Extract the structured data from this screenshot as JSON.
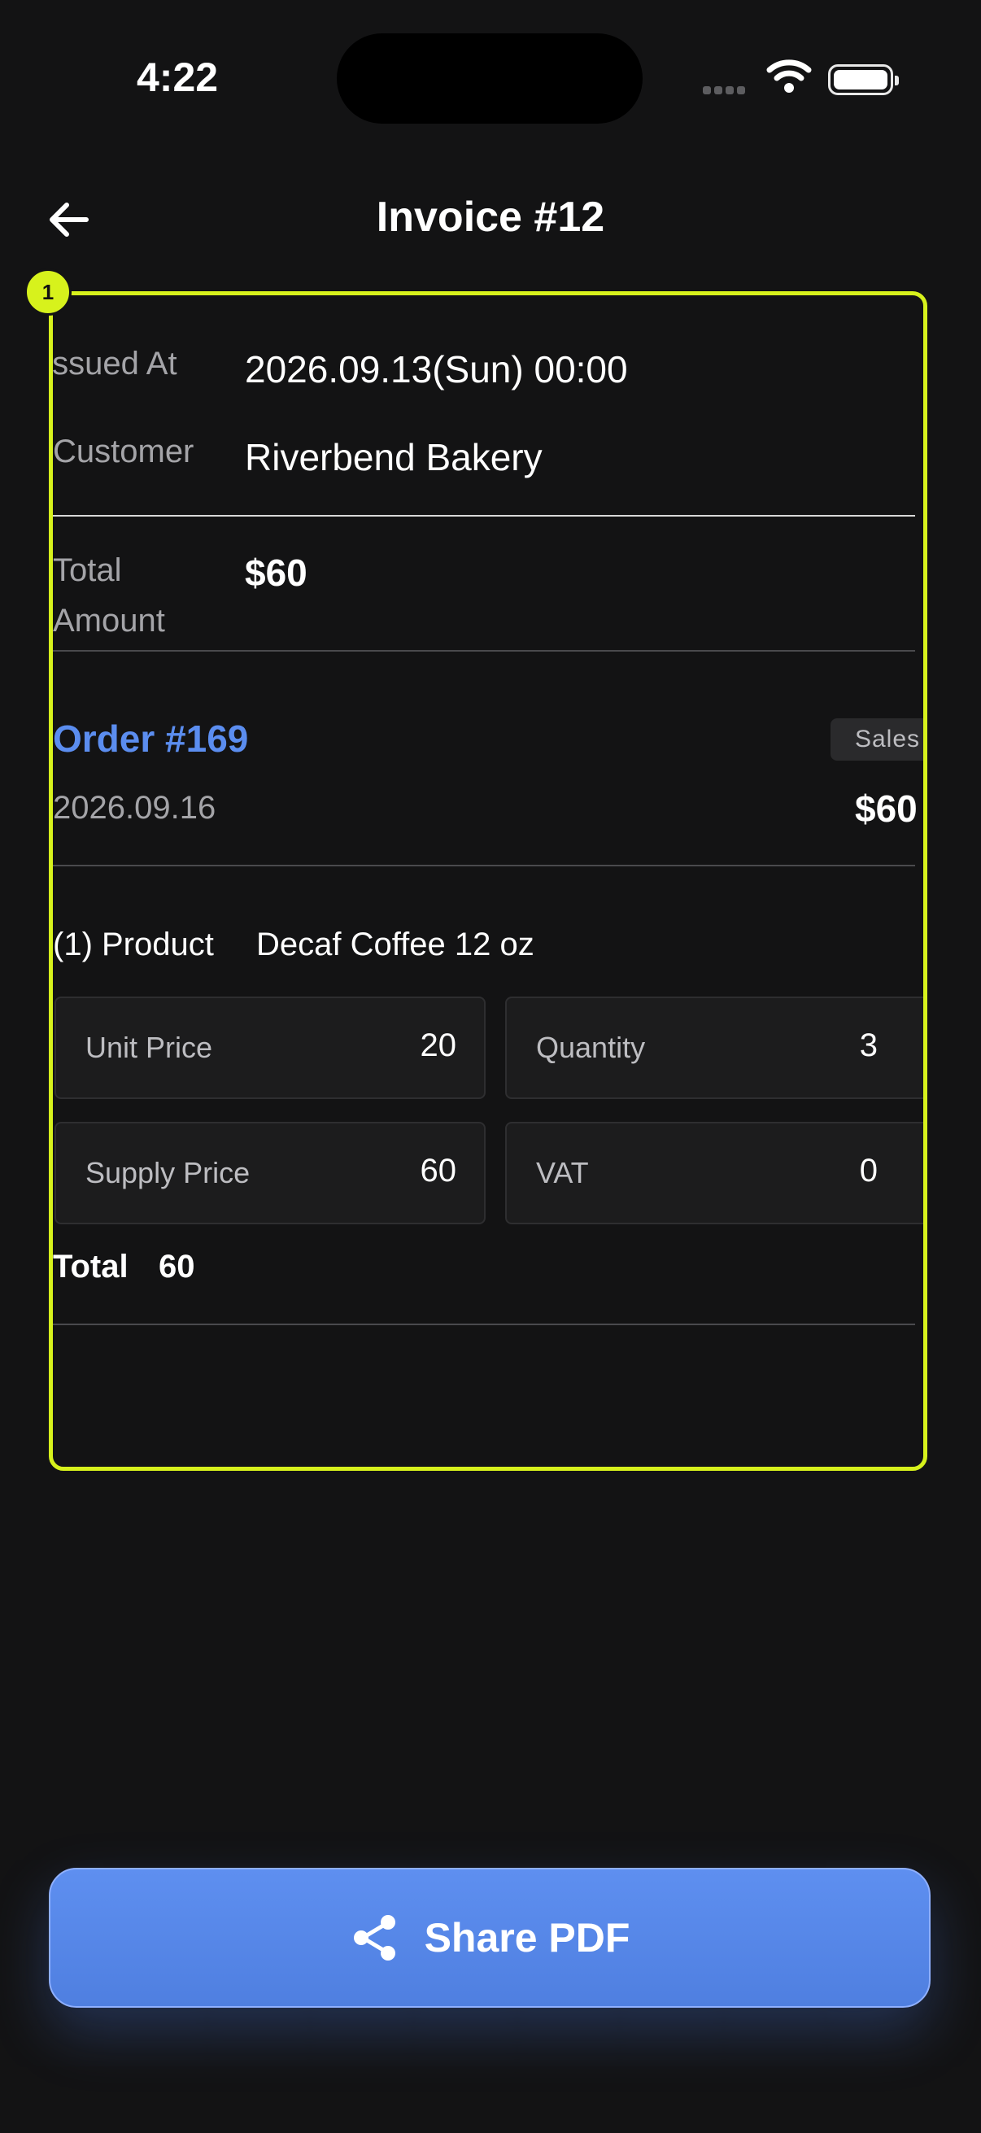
{
  "status_bar": {
    "time": "4:22"
  },
  "header": {
    "title": "Invoice #12"
  },
  "invoice": {
    "issued_at_label": "Issued At",
    "issued_at_value": "2026.09.13(Sun) 00:00",
    "customer_label": "Customer",
    "customer_value": "Riverbend Bakery",
    "total_amount_label_1": "Total",
    "total_amount_label_2": "Amount",
    "total_amount_value": "$60"
  },
  "order": {
    "title": "Order #169",
    "tag": "Sales",
    "date": "2026.09.16",
    "amount": "$60",
    "items": [
      {
        "index_label": "(1) Product",
        "name": "Decaf Coffee 12 oz",
        "unit_price_label": "Unit Price",
        "unit_price": "20",
        "quantity_label": "Quantity",
        "quantity": "3",
        "supply_price_label": "Supply Price",
        "supply_price": "60",
        "vat_label": "VAT",
        "vat": "0",
        "total_label": "Total",
        "total": "60"
      }
    ]
  },
  "annotation": {
    "marker": "1",
    "accent": "#d7f21c"
  },
  "actions": {
    "share_label": "Share PDF"
  },
  "colors": {
    "background": "#131314",
    "link": "#5b8def",
    "button": "#5b8def"
  }
}
